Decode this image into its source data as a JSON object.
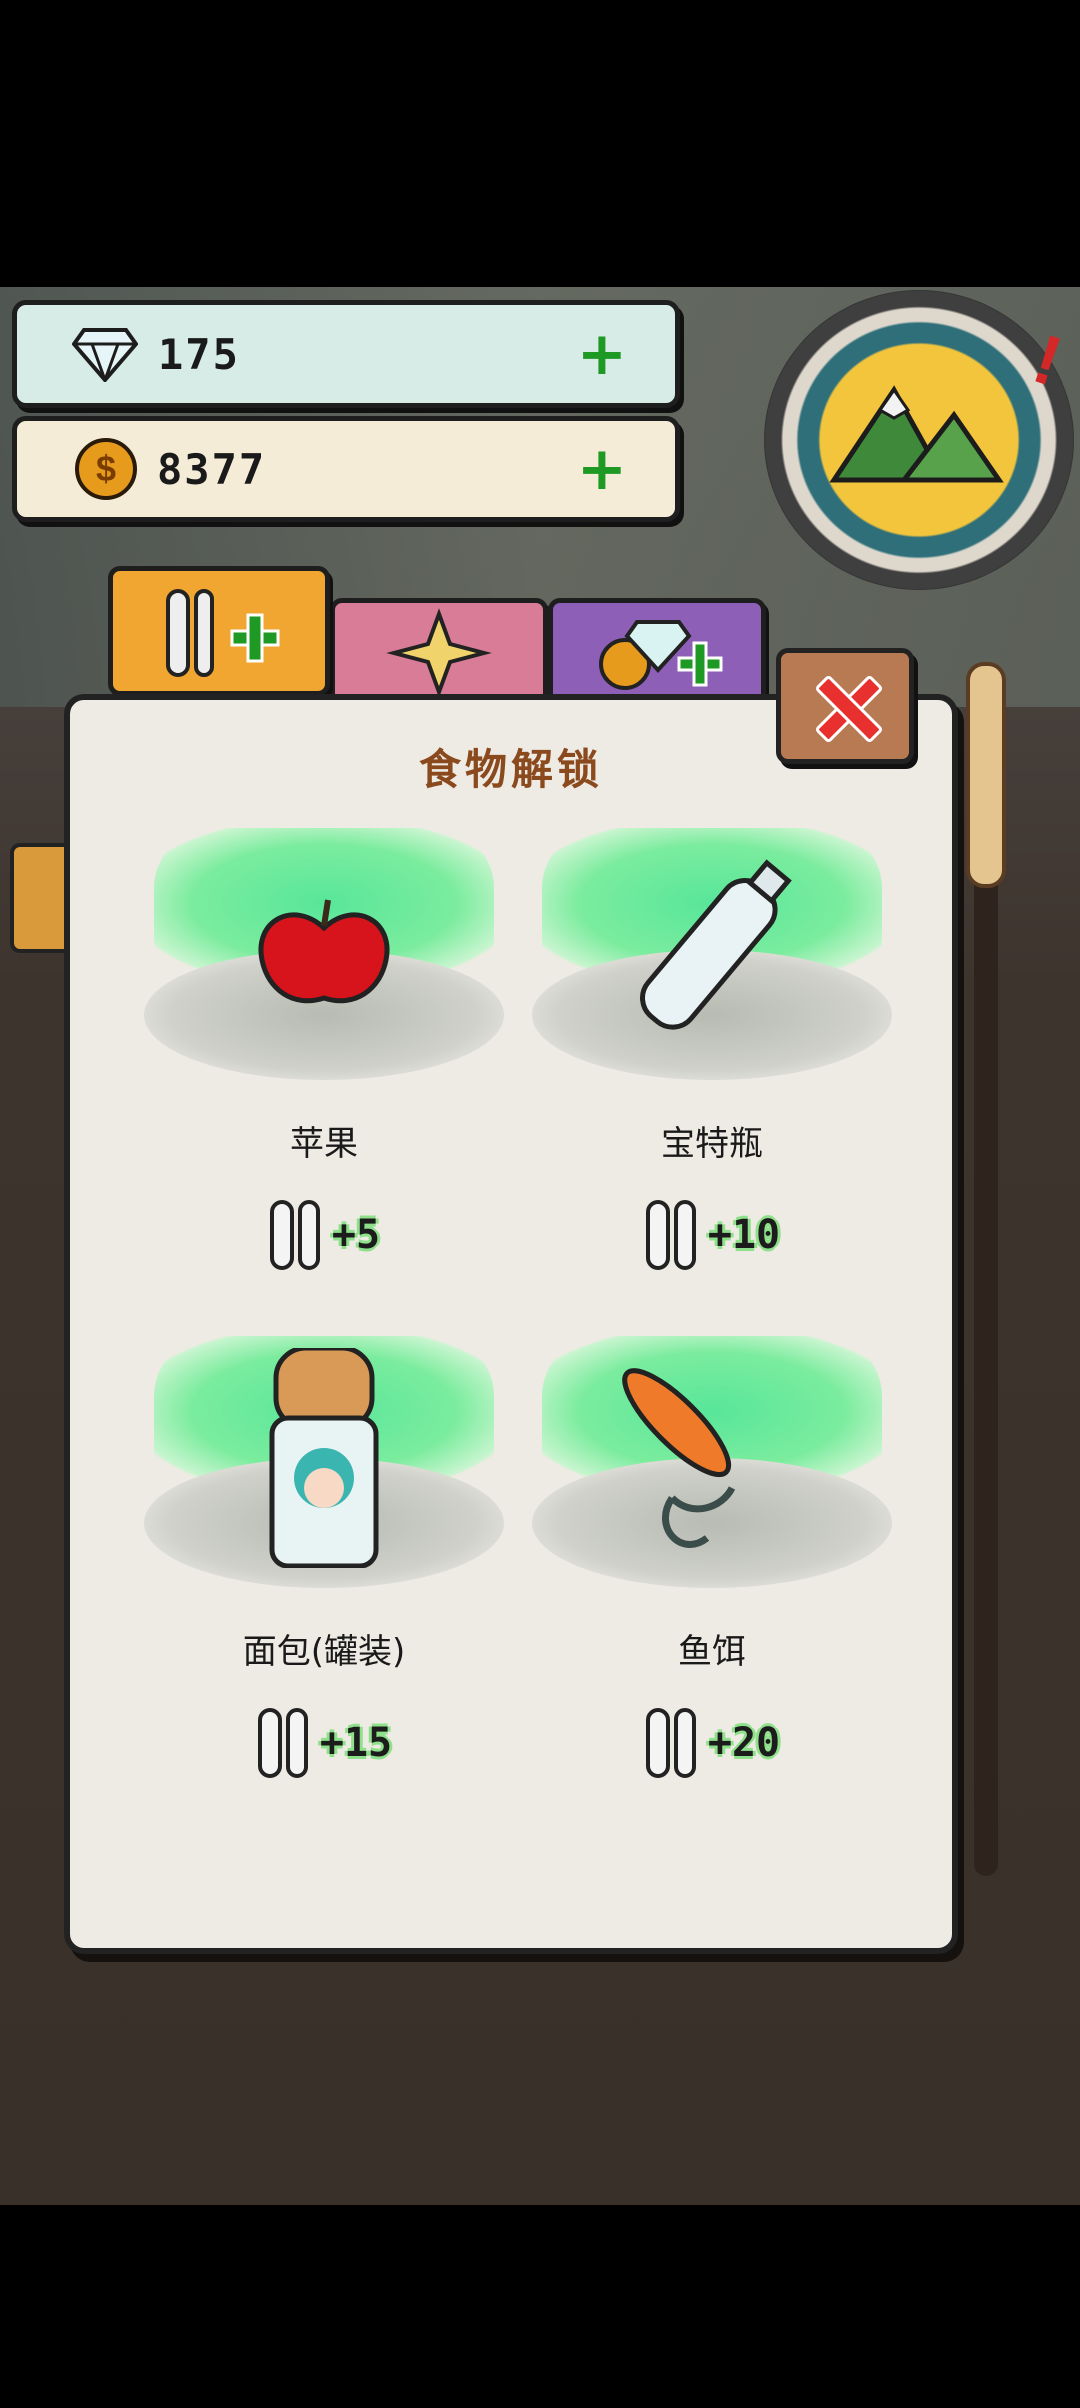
{
  "currencies": {
    "gems": {
      "icon": "diamond-icon",
      "value": "175",
      "add": "+"
    },
    "coins": {
      "icon": "coin-icon",
      "symbol": "$",
      "value": "8377",
      "add": "+"
    }
  },
  "map": {
    "icon": "mountain-icon",
    "alert": "!"
  },
  "tabs": [
    {
      "name": "food",
      "icon": "utensils-plus-icon",
      "active": true
    },
    {
      "name": "skins",
      "icon": "sparkle-gem-icon",
      "active": false
    },
    {
      "name": "exchange",
      "icon": "coin-gem-plus-icon",
      "active": false
    }
  ],
  "panel": {
    "title": "食物解锁",
    "items": [
      {
        "name": "苹果",
        "icon": "apple-icon",
        "reward": "+5"
      },
      {
        "name": "宝特瓶",
        "icon": "plastic-bottle-icon",
        "reward": "+10"
      },
      {
        "name": "面包(罐装)",
        "icon": "canned-bread-icon",
        "reward": "+15"
      },
      {
        "name": "鱼饵",
        "icon": "fishing-lure-icon",
        "reward": "+20"
      },
      {
        "name": "",
        "icon": "locked-item-icon",
        "reward": ""
      },
      {
        "name": "",
        "icon": "locked-item-icon",
        "reward": ""
      }
    ]
  },
  "colors": {
    "accent_green": "#1e9a24",
    "title_brown": "#8b4a1e",
    "close_red": "#e8312e",
    "food_tab": "#f2a632"
  }
}
